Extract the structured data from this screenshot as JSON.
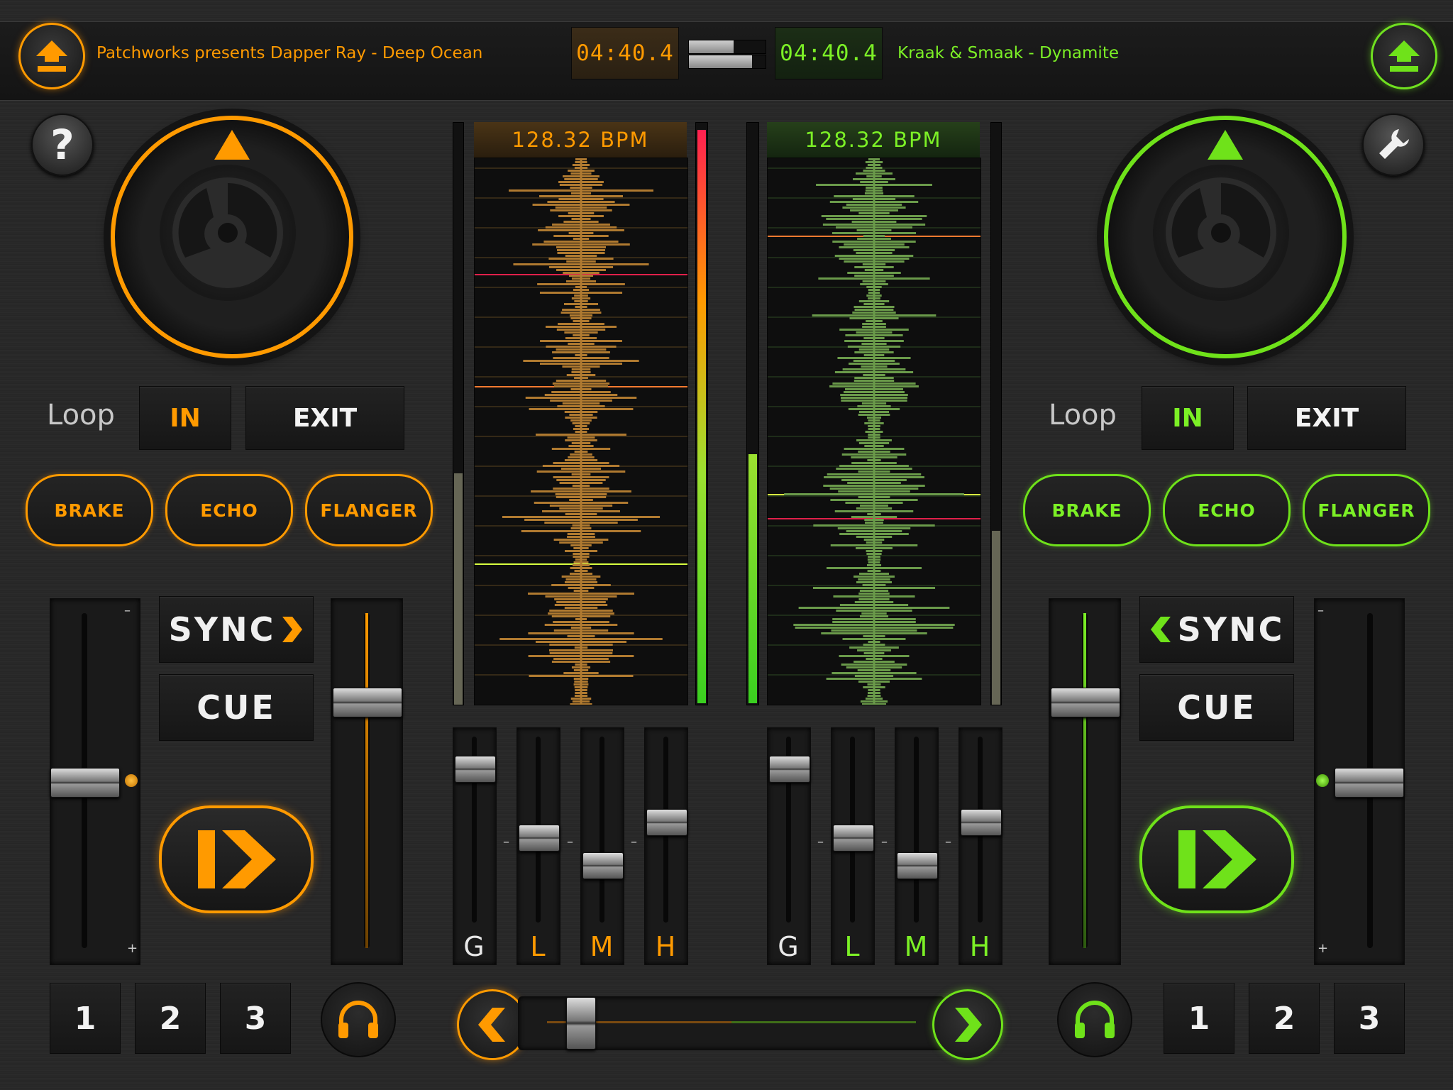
{
  "colors": {
    "left_accent": "#ff9a00",
    "right_accent": "#6fe21a",
    "background": "#262626"
  },
  "deck_left": {
    "track": "Patchworks presents Dapper Ray - Deep Ocean",
    "time": "04:40.4",
    "bpm": "128.32 BPM",
    "loop_label": "Loop",
    "loop_in": "IN",
    "loop_exit": "EXIT",
    "fx": [
      "BRAKE",
      "ECHO",
      "FLANGER"
    ],
    "sync": "SYNC",
    "cue": "CUE",
    "pitch_minus": "–",
    "pitch_plus": "+",
    "hotcues": [
      "1",
      "2",
      "3"
    ],
    "pitch_level": 0.5,
    "volume_level": 0.76,
    "level_meter": 0.4,
    "eq_labels": [
      "G",
      "L",
      "M",
      "H"
    ],
    "eq_levels": [
      0.88,
      0.45,
      0.28,
      0.55
    ],
    "icons": [
      "eject-icon",
      "record-hub-icon",
      "play-cue-icon",
      "headphones-icon"
    ]
  },
  "deck_right": {
    "track": "Kraak & Smaak - Dynamite",
    "time": "04:40.4",
    "bpm": "128.32 BPM",
    "loop_label": "Loop",
    "loop_in": "IN",
    "loop_exit": "EXIT",
    "fx": [
      "BRAKE",
      "ECHO",
      "FLANGER"
    ],
    "sync": "SYNC",
    "cue": "CUE",
    "pitch_minus": "–",
    "pitch_plus": "+",
    "hotcues": [
      "1",
      "2",
      "3"
    ],
    "pitch_level": 0.5,
    "volume_level": 0.76,
    "level_meter": 0.3,
    "eq_labels": [
      "G",
      "L",
      "M",
      "H"
    ],
    "eq_levels": [
      0.88,
      0.45,
      0.28,
      0.55
    ],
    "icons": [
      "eject-icon",
      "record-hub-icon",
      "play-cue-icon",
      "headphones-icon"
    ]
  },
  "toolbar": {
    "help_icon": "question-icon",
    "settings_icon": "wrench-icon"
  },
  "crossfader": {
    "position": 0.12
  }
}
